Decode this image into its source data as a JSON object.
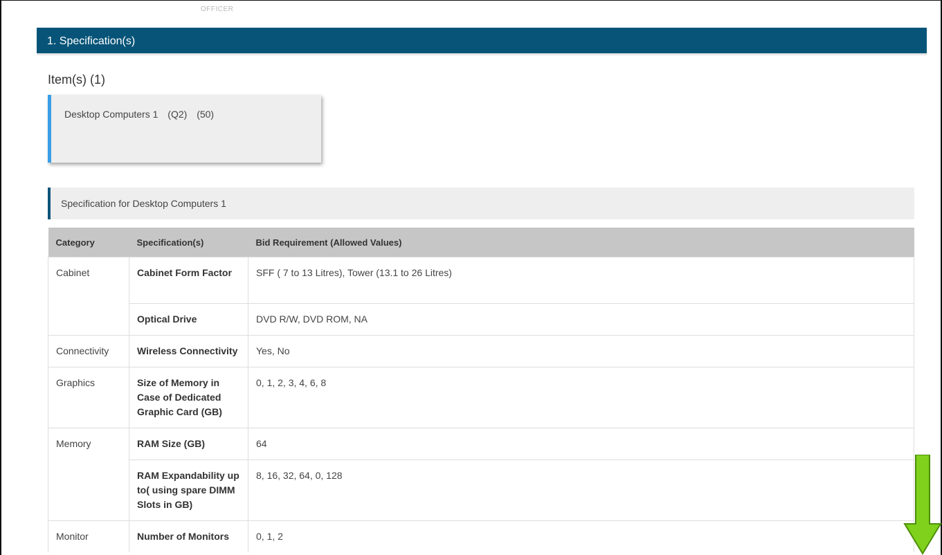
{
  "header": {
    "officer_label": "OFFICER"
  },
  "section": {
    "title": "1. Specification(s)"
  },
  "items": {
    "title": "Item(s) (1)",
    "list": [
      {
        "name": "Desktop Computers 1",
        "code": "(Q2)",
        "qty": "(50)"
      }
    ]
  },
  "spec_panel": {
    "label": "Specification for Desktop Computers 1"
  },
  "table": {
    "headers": [
      "Category",
      "Specification(s)",
      "Bid Requirement (Allowed Values)"
    ],
    "groups": [
      {
        "category": "Cabinet",
        "rows": [
          {
            "spec": "Cabinet Form Factor",
            "value": "SFF ( 7 to 13 Litres), Tower (13.1 to 26 Litres)"
          },
          {
            "spec": "Optical Drive",
            "value": "DVD R/W, DVD ROM, NA"
          }
        ]
      },
      {
        "category": "Connectivity",
        "rows": [
          {
            "spec": "Wireless Connectivity",
            "value": "Yes, No"
          }
        ]
      },
      {
        "category": "Graphics",
        "rows": [
          {
            "spec": "Size of Memory in Case of Dedicated Graphic Card (GB)",
            "value": "0, 1, 2, 3, 4, 6, 8"
          }
        ]
      },
      {
        "category": "Memory",
        "rows": [
          {
            "spec": "RAM Size (GB)",
            "value": "64"
          },
          {
            "spec": "RAM Expandability up to( using spare DIMM Slots in GB)",
            "value": "8, 16, 32, 64, 0, 128"
          }
        ]
      },
      {
        "category": "Monitor",
        "rows": [
          {
            "spec": "Number of Monitors",
            "value": "0, 1, 2"
          }
        ]
      }
    ]
  },
  "colors": {
    "header_bg": "#075478",
    "item_accent": "#3a9ee6",
    "arrow": "#7fd11b"
  },
  "icons": {
    "scroll_arrow": "arrow-down-icon"
  }
}
